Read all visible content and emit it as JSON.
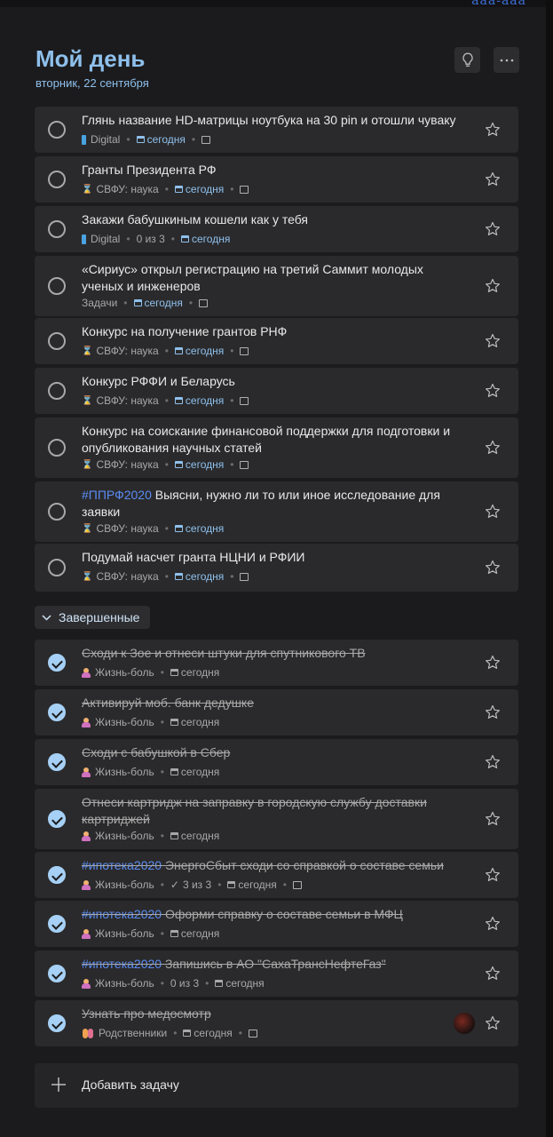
{
  "page": {
    "title": "Мой день",
    "subtitle": "вторник, 22 сентября",
    "completed_label": "Завершенные",
    "add_task_label": "Добавить задачу"
  },
  "tasks": [
    {
      "title": "Глянь название HD-матрицы ноутбука на 30 pin и отошли чуваку",
      "list": "Digital",
      "steps": "",
      "due": "сегодня",
      "note": true
    },
    {
      "title": "Гранты  Президента РФ",
      "list": "СВФУ: наука",
      "steps": "",
      "due": "сегодня",
      "note": true
    },
    {
      "title": "Закажи бабушкиным кошели как у тебя",
      "list": "Digital",
      "steps": "0 из 3",
      "due": "сегодня",
      "note": false
    },
    {
      "title": "«Сириус» открыл регистрацию на третий Саммит молодых ученых и инженеров",
      "list": "Задачи",
      "steps": "",
      "due": "сегодня",
      "note": true
    },
    {
      "title": "Конкурс на получение грантов РНФ",
      "list": "СВФУ: наука",
      "steps": "",
      "due": "сегодня",
      "note": true
    },
    {
      "title": "Конкурс РФФИ и Беларусь",
      "list": "СВФУ: наука",
      "steps": "",
      "due": "сегодня",
      "note": true
    },
    {
      "title": "Конкурс на соискание финансовой поддержки для подготовки и опубликования научных статей",
      "list": "СВФУ: наука",
      "steps": "",
      "due": "сегодня",
      "note": true
    },
    {
      "tag": "#ППРФ2020",
      "title": "Выясни, нужно ли то или иное исследование для заявки",
      "list": "СВФУ: наука",
      "steps": "",
      "due": "сегодня",
      "note": false
    },
    {
      "title": "Подумай насчет гранта НЦНИ и РФИИ",
      "list": "СВФУ: наука",
      "steps": "",
      "due": "сегодня",
      "note": true
    }
  ],
  "completed": [
    {
      "title": "Сходи к Зое и отнеси штуки для спутникового ТВ",
      "list": "Жизнь-боль",
      "steps": "",
      "due": "сегодня",
      "note": false
    },
    {
      "title": "Активируй моб. банк дедушке",
      "list": "Жизнь-боль",
      "steps": "",
      "due": "сегодня",
      "note": false
    },
    {
      "title": "Сходи с бабушкой в Сбер",
      "list": "Жизнь-боль",
      "steps": "",
      "due": "сегодня",
      "note": false
    },
    {
      "title": "Отнеси картридж на заправку в городскую службу доставки картриджей",
      "list": "Жизнь-боль",
      "steps": "",
      "due": "сегодня",
      "note": false
    },
    {
      "tag": "#ипотека2020",
      "title": "ЭнергоСбыт сходи со справкой о составе семьи",
      "list": "Жизнь-боль",
      "steps": "3 из 3",
      "due": "сегодня",
      "note": true
    },
    {
      "tag": "#ипотека2020",
      "title": "Оформи справку о составе семьи в МФЦ",
      "list": "Жизнь-боль",
      "steps": "",
      "due": "сегодня",
      "note": false
    },
    {
      "tag": "#ипотека2020",
      "title": "Запишись в АО \"СахаТрансНефтеГаз\"",
      "list": "Жизнь-боль",
      "steps": "0 из 3",
      "due": "сегодня",
      "note": false
    },
    {
      "title": "Узнать про медосмотр",
      "list": "Родственники",
      "steps": "",
      "due": "сегодня",
      "note": true
    }
  ],
  "colors": {
    "accent": "#8fc0ec",
    "tag": "#5b8cf2",
    "background": "#1b1b1d",
    "card": "#2a2a2c",
    "done_check": "#a6d0f5"
  },
  "icons": {
    "digital": "phone-icon",
    "science": "hourglass-icon",
    "life": "person-icon",
    "family": "family-icon"
  }
}
